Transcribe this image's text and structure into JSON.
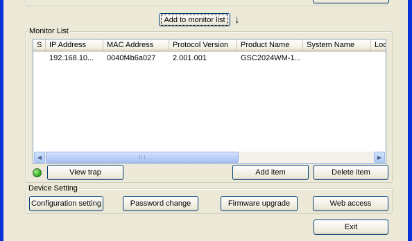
{
  "add_to_monitor_button": "Add to monitor list",
  "monitor_list": {
    "legend": "Monitor List",
    "columns": [
      "S",
      "IP Address",
      "MAC Address",
      "Protocol Version",
      "Product Name",
      "System Name",
      "Loca"
    ],
    "rows": [
      {
        "s": "",
        "ip": "192.168.10...",
        "mac": "0040f4b6a027",
        "protocol": "2.001.001",
        "product": "GSC2024WM-1...",
        "system": "",
        "location": ""
      }
    ]
  },
  "status_led_color": "#2aa417",
  "view_trap_button": "View trap",
  "add_item_button": "Add item",
  "delete_item_button": "Delete item",
  "device_setting": {
    "legend": "Device Setting",
    "buttons": [
      "Configuration setting",
      "Password change",
      "Firmware upgrade",
      "Web access"
    ]
  },
  "exit_button": "Exit",
  "colors": {
    "window_frame": "#0831d9",
    "face": "#ece9d8",
    "button_border": "#003c74",
    "listview_border": "#7f9db9"
  },
  "icons": {
    "down_arrow": "down-arrow-icon",
    "scroll_left": "scroll-left-icon",
    "scroll_right": "scroll-right-icon",
    "status": "status-led-icon"
  }
}
